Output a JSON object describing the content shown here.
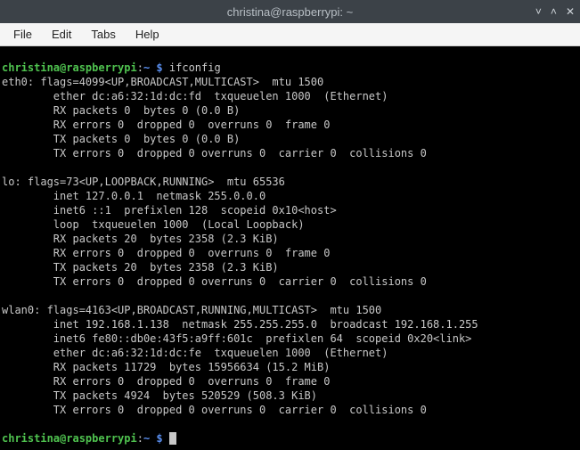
{
  "window": {
    "title": "christina@raspberrypi: ~",
    "controls": {
      "min": "˅",
      "max": "˄",
      "close": "✕"
    }
  },
  "menu": {
    "file": "File",
    "edit": "Edit",
    "tabs": "Tabs",
    "help": "Help"
  },
  "prompt": {
    "user_host": "christina@raspberrypi",
    "sep": ":",
    "path": "~",
    "dollar": "$",
    "command": "ifconfig"
  },
  "ifconfig": {
    "eth0": {
      "header": "eth0: flags=4099<UP,BROADCAST,MULTICAST>  mtu 1500",
      "l1": "        ether dc:a6:32:1d:dc:fd  txqueuelen 1000  (Ethernet)",
      "l2": "        RX packets 0  bytes 0 (0.0 B)",
      "l3": "        RX errors 0  dropped 0  overruns 0  frame 0",
      "l4": "        TX packets 0  bytes 0 (0.0 B)",
      "l5": "        TX errors 0  dropped 0 overruns 0  carrier 0  collisions 0"
    },
    "lo": {
      "header": "lo: flags=73<UP,LOOPBACK,RUNNING>  mtu 65536",
      "l1": "        inet 127.0.0.1  netmask 255.0.0.0",
      "l2": "        inet6 ::1  prefixlen 128  scopeid 0x10<host>",
      "l3": "        loop  txqueuelen 1000  (Local Loopback)",
      "l4": "        RX packets 20  bytes 2358 (2.3 KiB)",
      "l5": "        RX errors 0  dropped 0  overruns 0  frame 0",
      "l6": "        TX packets 20  bytes 2358 (2.3 KiB)",
      "l7": "        TX errors 0  dropped 0 overruns 0  carrier 0  collisions 0"
    },
    "wlan0": {
      "header": "wlan0: flags=4163<UP,BROADCAST,RUNNING,MULTICAST>  mtu 1500",
      "l1": "        inet 192.168.1.138  netmask 255.255.255.0  broadcast 192.168.1.255",
      "l2": "        inet6 fe80::db0e:43f5:a9ff:601c  prefixlen 64  scopeid 0x20<link>",
      "l3": "        ether dc:a6:32:1d:dc:fe  txqueuelen 1000  (Ethernet)",
      "l4": "        RX packets 11729  bytes 15956634 (15.2 MiB)",
      "l5": "        RX errors 0  dropped 0  overruns 0  frame 0",
      "l6": "        TX packets 4924  bytes 520529 (508.3 KiB)",
      "l7": "        TX errors 0  dropped 0 overruns 0  carrier 0  collisions 0"
    }
  }
}
